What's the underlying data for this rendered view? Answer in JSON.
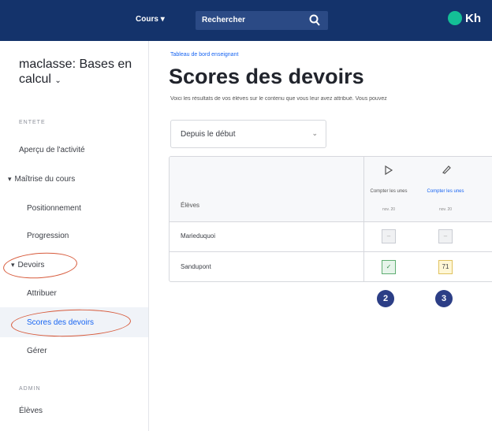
{
  "header": {
    "nav_courses": "Cours",
    "search_label": "Rechercher",
    "logo_text": "Kh"
  },
  "sidebar": {
    "class_name": "maclasse: Bases en calcul",
    "section_general": "ENTETE",
    "activity_overview": "Aperçu de l'activité",
    "course_mastery": "Maîtrise du cours",
    "positioning": "Positionnement",
    "progression": "Progression",
    "assignments": "Devoirs",
    "assign": "Attribuer",
    "assignment_scores": "Scores des devoirs",
    "manage": "Gérer",
    "section_admin": "ADMIN",
    "students": "Élèves"
  },
  "main": {
    "breadcrumb": "Tableau de bord enseignant",
    "title": "Scores des devoirs",
    "description": "Voici les résultats de vos élèves sur le contenu que vous leur avez attribué. Vous pouvez",
    "filter_value": "Depuis le début"
  },
  "table": {
    "header_students": "Élèves",
    "columns": [
      {
        "title": "Compter les unes",
        "date": "nov. 20"
      },
      {
        "title": "Compter les unes",
        "date": "nov. 20"
      }
    ],
    "rows": [
      {
        "name": "Marieduquoi",
        "cells": [
          "–",
          "–"
        ]
      },
      {
        "name": "Sandupont",
        "cells": [
          "✓",
          "71"
        ]
      }
    ]
  },
  "markers": [
    "2",
    "3"
  ],
  "colors": {
    "topbar": "#14336b",
    "accent": "#1865f2",
    "annotation": "#d75a3b",
    "marker": "#2c3e86"
  }
}
